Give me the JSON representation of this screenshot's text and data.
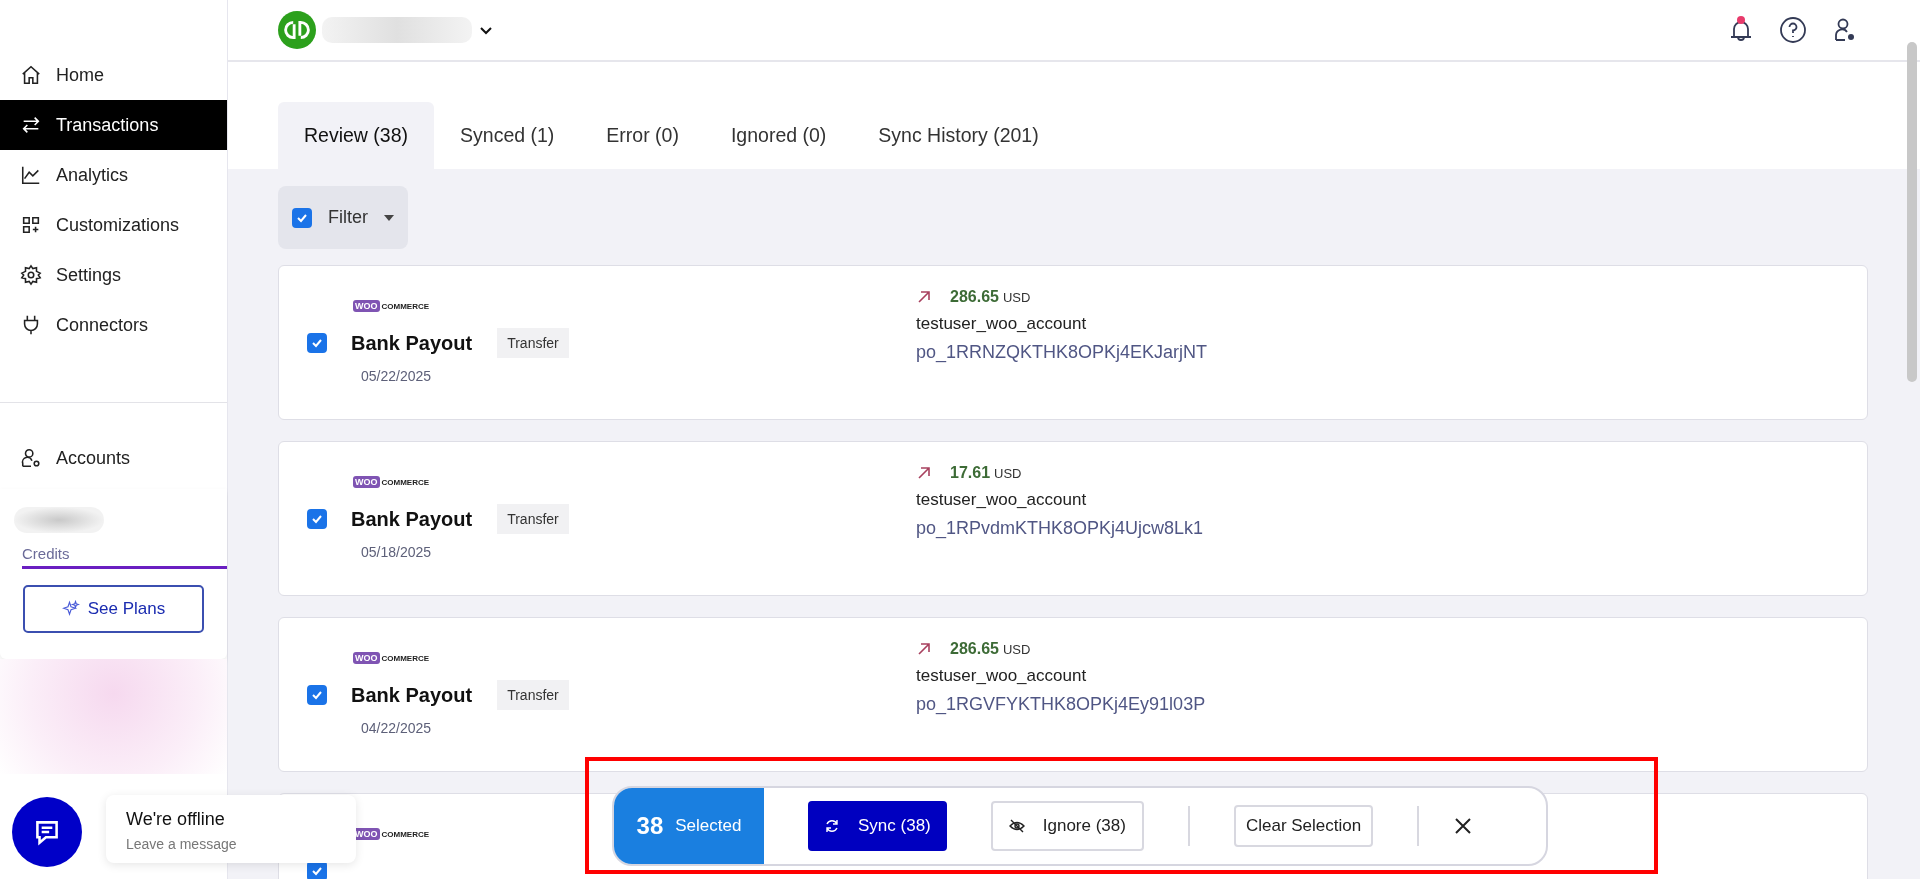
{
  "sidebar": {
    "items": [
      {
        "label": "Home",
        "selected": false
      },
      {
        "label": "Transactions",
        "selected": true
      },
      {
        "label": "Analytics",
        "selected": false
      },
      {
        "label": "Customizations",
        "selected": false
      },
      {
        "label": "Settings",
        "selected": false
      },
      {
        "label": "Connectors",
        "selected": false
      }
    ],
    "accounts": "Accounts",
    "credits_label": "Credits",
    "see_plans": "See Plans"
  },
  "header": {
    "has_notifications": true
  },
  "tabs": [
    {
      "label": "Review (38)",
      "selected": true
    },
    {
      "label": "Synced (1)",
      "selected": false
    },
    {
      "label": "Error (0)",
      "selected": false
    },
    {
      "label": "Ignored (0)",
      "selected": false
    },
    {
      "label": "Sync History (201)",
      "selected": false
    }
  ],
  "filter": {
    "label": "Filter",
    "checked": true
  },
  "transactions": [
    {
      "checked": true,
      "logo_badge": "WOO",
      "logo_text": "COMMERCE",
      "title": "Bank Payout",
      "tag": "Transfer",
      "date": "05/22/2025",
      "amount": "286.65",
      "currency": "USD",
      "account": "testuser_woo_account",
      "payout_id": "po_1RRNZQKTHK8OPKj4EKJarjNT"
    },
    {
      "checked": true,
      "logo_badge": "WOO",
      "logo_text": "COMMERCE",
      "title": "Bank Payout",
      "tag": "Transfer",
      "date": "05/18/2025",
      "amount": "17.61",
      "currency": "USD",
      "account": "testuser_woo_account",
      "payout_id": "po_1RPvdmKTHK8OPKj4Ujcw8Lk1"
    },
    {
      "checked": true,
      "logo_badge": "WOO",
      "logo_text": "COMMERCE",
      "title": "Bank Payout",
      "tag": "Transfer",
      "date": "04/22/2025",
      "amount": "286.65",
      "currency": "USD",
      "account": "testuser_woo_account",
      "payout_id": "po_1RGVFYKTHK8OPKj4Ey91l03P"
    },
    {
      "checked": true,
      "logo_badge": "WOO",
      "logo_text": "COMMERCE"
    }
  ],
  "bulk_bar": {
    "count": "38",
    "count_label": "Selected",
    "sync": "Sync (38)",
    "ignore": "Ignore (38)",
    "clear": "Clear Selection"
  },
  "chat": {
    "title": "We're offline",
    "subtitle": "Leave a message"
  }
}
